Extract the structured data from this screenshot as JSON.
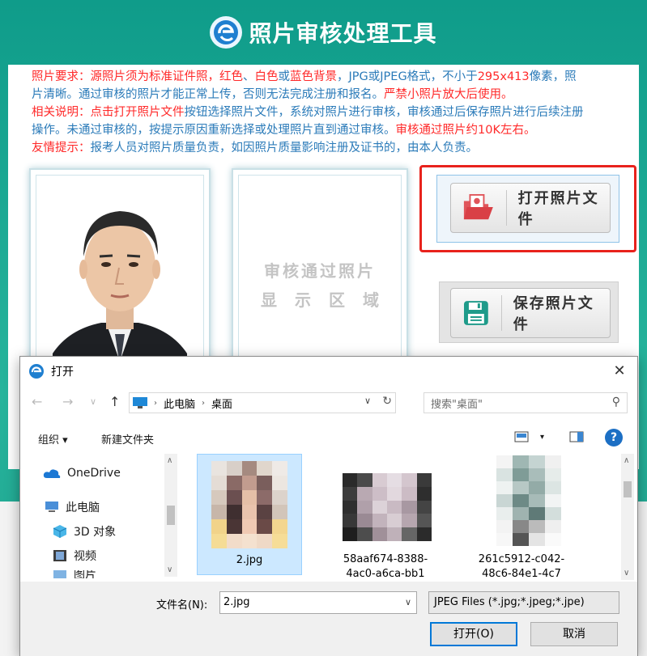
{
  "app": {
    "title": "照片审核处理工具",
    "notice": {
      "line1_prefix": "照片要求：源照片须为标准证件照，",
      "line1_red1": "红色",
      "line1_sep1": "、",
      "line1_red2": "白色",
      "line1_sep2": "或",
      "line1_red3": "蓝色背景",
      "line1_rest": "，JPG或JPEG格式，不小于",
      "line1_size": "295x413",
      "line1_tail": "像素，照",
      "line2": "片清晰。通过审核的照片才能正常上传，否则无法完成注册和报名。",
      "line2_red": "严禁小照片放大后使用。",
      "line3_prefix": "相关说明：点击",
      "line3_red": "打开照片文件",
      "line3_rest": "按钮选择照片文件，系统对照片进行审核，审核通过后保存照片进行后续注册",
      "line4": "操作。未通过审核的，按提示原因重新选择或处理照片直到通过审核。",
      "line4_red": "审核通过照片约10K左右。",
      "line5_prefix": "友情提示：",
      "line5_rest": "报考人员对照片质量负责，如因照片质量影响注册及证书的，由本人负责。"
    },
    "placeholder": {
      "line1": "审核通过照片",
      "line2": "显示区域"
    },
    "open_button": "打开照片文件",
    "save_button": "保存照片文件"
  },
  "dialog": {
    "title": "打开",
    "address": [
      "此电脑",
      "桌面"
    ],
    "search_placeholder": "搜索\"桌面\"",
    "toolbar": {
      "organize": "组织 ▾",
      "new_folder": "新建文件夹"
    },
    "nav_items": [
      {
        "label": "OneDrive",
        "icon": "cloud-icon"
      },
      {
        "label": "此电脑",
        "icon": "computer-icon"
      },
      {
        "label": "3D 对象",
        "icon": "cube-icon"
      },
      {
        "label": "视频",
        "icon": "film-icon"
      },
      {
        "label": "图片",
        "icon": "picture-icon"
      }
    ],
    "files": [
      {
        "name": "2.jpg",
        "selected": true
      },
      {
        "name": "58aaf674-8388-",
        "name2": "4ac0-a6ca-bb1"
      },
      {
        "name": "261c5912-c042-",
        "name2": "48c6-84e1-4c7"
      }
    ],
    "filename_label": "文件名(N):",
    "filename_value": "2.jpg",
    "filetype": "JPEG Files (*.jpg;*.jpeg;*.jpe)",
    "open_button": "打开(O)",
    "cancel_button": "取消"
  }
}
